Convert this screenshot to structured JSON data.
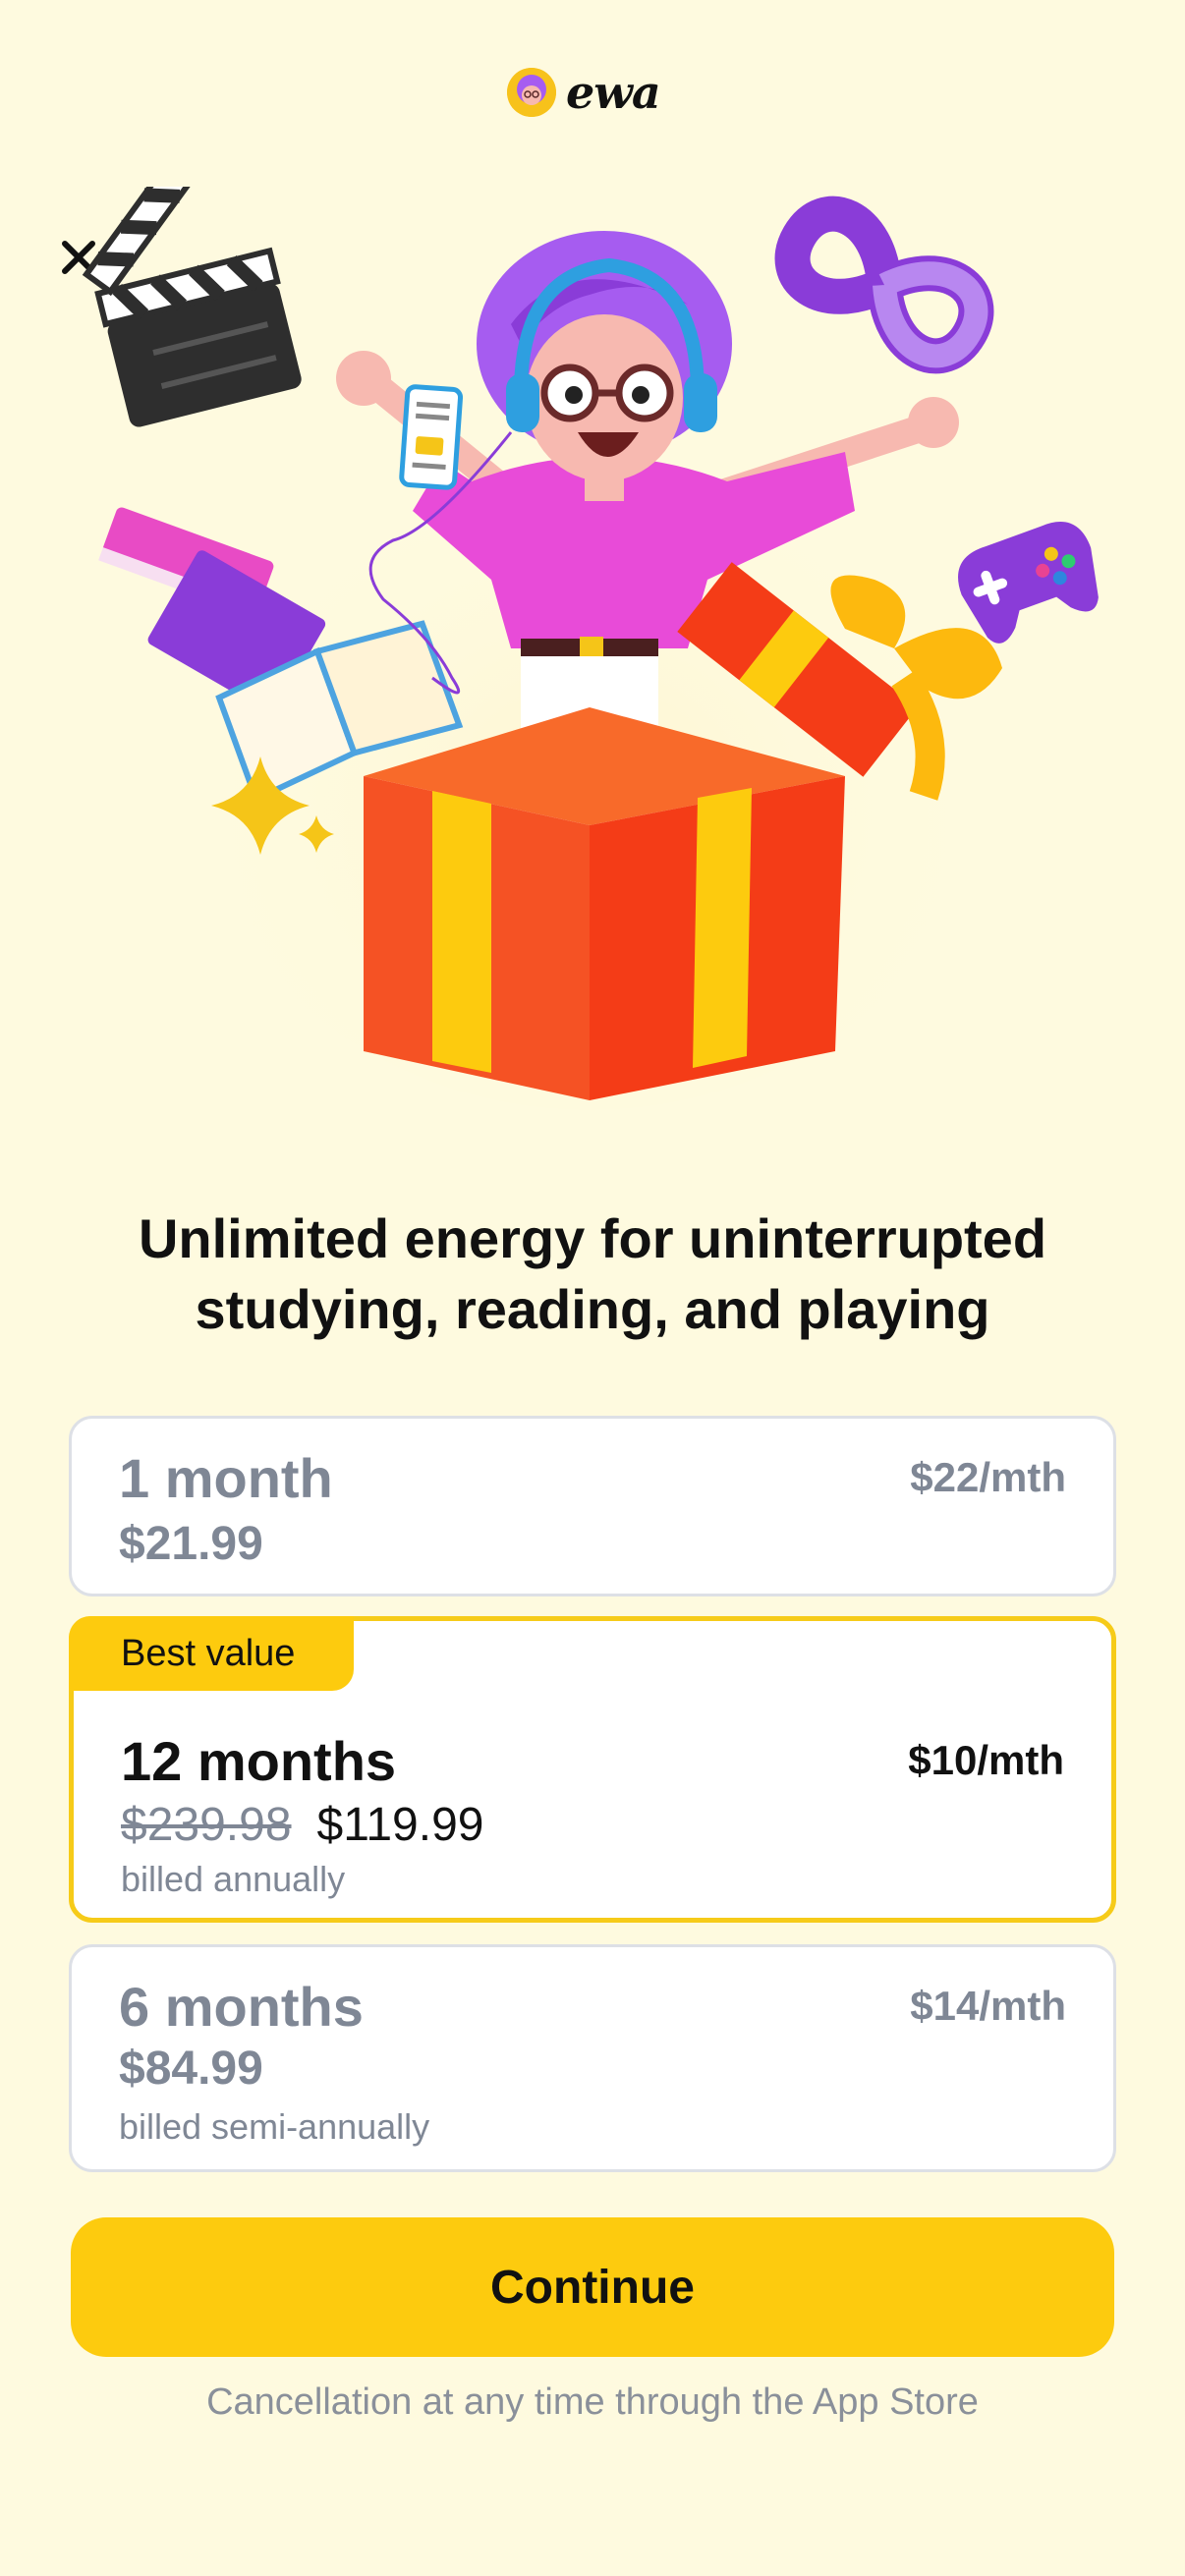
{
  "header": {
    "logo_text": "ewa"
  },
  "headline": {
    "line1": "Unlimited energy for uninterrupted",
    "line2": "studying, reading, and playing"
  },
  "plans": [
    {
      "name": "1 month",
      "monthly": "$22/mth",
      "price": "$21.99",
      "note": "",
      "selected": false
    },
    {
      "badge": "Best value",
      "name": "12 months",
      "monthly": "$10/mth",
      "old_price": "$239.98",
      "price": "$119.99",
      "note": "billed annually",
      "selected": true
    },
    {
      "name": "6 months",
      "monthly": "$14/mth",
      "price": "$84.99",
      "note": "billed semi-annually",
      "selected": false
    }
  ],
  "continue_label": "Continue",
  "footnote": "Cancellation at any time through the App Store",
  "colors": {
    "background": "#FEFADF",
    "accent": "#FDCB0E",
    "muted_text": "#7F8795",
    "card_border": "#DDE0E6"
  },
  "icons": [
    "close-icon",
    "clapperboard-icon",
    "infinity-icon",
    "gamepad-icon",
    "books-icon",
    "sparkle-icon",
    "gift-box-icon",
    "phone-icon",
    "headphones-icon"
  ]
}
